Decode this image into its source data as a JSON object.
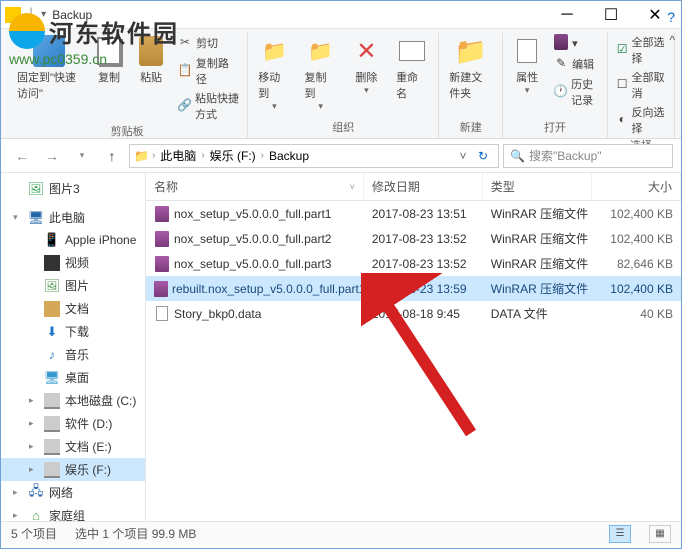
{
  "watermark": {
    "title": "河东软件园",
    "url": "www.pc0359.cn"
  },
  "window": {
    "title": "Backup"
  },
  "ribbon": {
    "pin": "固定到\"快速访问\"",
    "copy": "复制",
    "paste": "粘贴",
    "cut": "剪切",
    "copypath": "复制路径",
    "pasteshortcut": "粘贴快捷方式",
    "group_clipboard": "剪贴板",
    "moveto": "移动到",
    "copyto": "复制到",
    "delete": "删除",
    "rename": "重命名",
    "group_organize": "组织",
    "newfolder": "新建文件夹",
    "group_new": "新建",
    "properties": "属性",
    "edit": "编辑",
    "history": "历史记录",
    "group_open": "打开",
    "selectall": "全部选择",
    "selectnone": "全部取消",
    "selectinvert": "反向选择",
    "group_select": "选择"
  },
  "breadcrumb": {
    "pc": "此电脑",
    "drive": "娱乐 (F:)",
    "folder": "Backup"
  },
  "search": {
    "placeholder": "搜索\"Backup\""
  },
  "sidebar": {
    "items": [
      {
        "label": "图片3",
        "icon": "si-pic",
        "exp": ""
      },
      {
        "label": "此电脑",
        "icon": "si-pc",
        "exp": "▾",
        "bold": true
      },
      {
        "label": "Apple iPhone",
        "icon": "si-phone",
        "indent": 1
      },
      {
        "label": "视频",
        "icon": "si-vid",
        "indent": 1
      },
      {
        "label": "图片",
        "icon": "si-img",
        "indent": 1
      },
      {
        "label": "文档",
        "icon": "si-doc",
        "indent": 1
      },
      {
        "label": "下载",
        "icon": "si-dl",
        "indent": 1
      },
      {
        "label": "音乐",
        "icon": "si-music",
        "indent": 1
      },
      {
        "label": "桌面",
        "icon": "si-desk",
        "indent": 1
      },
      {
        "label": "本地磁盘 (C:)",
        "icon": "si-drive",
        "indent": 1,
        "exp": "▸"
      },
      {
        "label": "软件 (D:)",
        "icon": "si-drive",
        "indent": 1,
        "exp": "▸"
      },
      {
        "label": "文档 (E:)",
        "icon": "si-drive",
        "indent": 1,
        "exp": "▸"
      },
      {
        "label": "娱乐 (F:)",
        "icon": "si-drive",
        "indent": 1,
        "exp": "▸",
        "selected": true
      },
      {
        "label": "网络",
        "icon": "si-net",
        "exp": "▸"
      },
      {
        "label": "家庭组",
        "icon": "si-home",
        "exp": "▸"
      }
    ]
  },
  "columns": {
    "name": "名称",
    "date": "修改日期",
    "type": "类型",
    "size": "大小"
  },
  "files": [
    {
      "name": "nox_setup_v5.0.0.0_full.part1",
      "date": "2017-08-23 13:51",
      "type": "WinRAR 压缩文件",
      "size": "102,400 KB",
      "icon": "rar"
    },
    {
      "name": "nox_setup_v5.0.0.0_full.part2",
      "date": "2017-08-23 13:52",
      "type": "WinRAR 压缩文件",
      "size": "102,400 KB",
      "icon": "rar"
    },
    {
      "name": "nox_setup_v5.0.0.0_full.part3",
      "date": "2017-08-23 13:52",
      "type": "WinRAR 压缩文件",
      "size": "82,646 KB",
      "icon": "rar"
    },
    {
      "name": "rebuilt.nox_setup_v5.0.0.0_full.part1",
      "date": "2017-08-23 13:59",
      "type": "WinRAR 压缩文件",
      "size": "102,400 KB",
      "icon": "rar",
      "selected": true
    },
    {
      "name": "Story_bkp0.data",
      "date": "2017-08-18 9:45",
      "type": "DATA 文件",
      "size": "40 KB",
      "icon": "file"
    }
  ],
  "status": {
    "count": "5 个项目",
    "selection": "选中 1 个项目  99.9 MB"
  }
}
